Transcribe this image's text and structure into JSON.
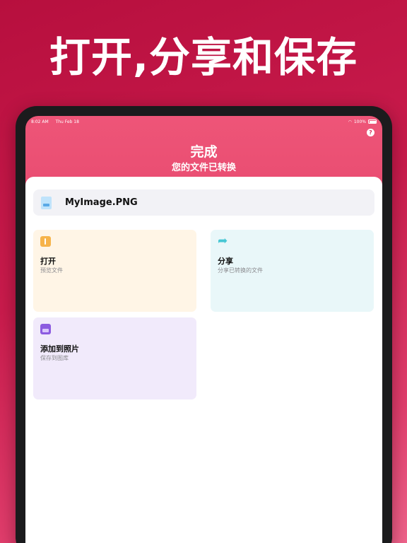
{
  "headline": "打开,分享和保存",
  "status_bar": {
    "time": "8:02 AM",
    "date": "Thu Feb 18",
    "battery": "100%"
  },
  "header": {
    "help_label": "?",
    "title": "完成",
    "subtitle": "您的文件已转换"
  },
  "file": {
    "name": "MyImage.PNG",
    "icon": "image-file-icon"
  },
  "actions": [
    {
      "title": "打开",
      "subtitle": "预览文件",
      "icon": "open-file-icon",
      "color": "#fff5e6"
    },
    {
      "title": "分享",
      "subtitle": "分享已转换的文件",
      "icon": "share-arrow-icon",
      "color": "#e9f7f9"
    },
    {
      "title": "添加到照片",
      "subtitle": "保存到图库",
      "icon": "photos-icon",
      "color": "#f1eafb"
    }
  ],
  "colors": {
    "brand_gradient_top": "#b70f3e",
    "brand_gradient_bottom": "#f0648c",
    "header_pink": "#de3a62"
  }
}
